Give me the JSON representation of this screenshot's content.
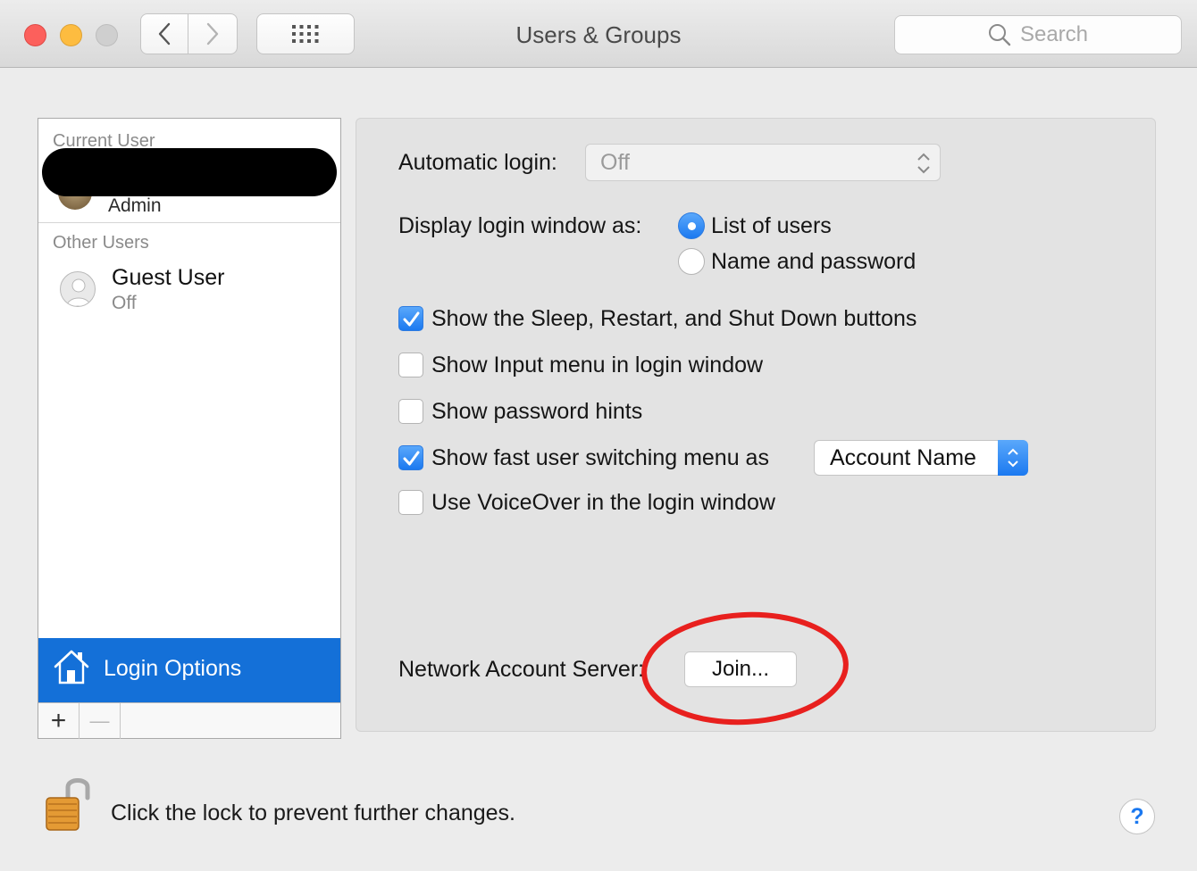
{
  "window": {
    "title": "Users & Groups",
    "search_placeholder": "Search"
  },
  "sidebar": {
    "current_user_label": "Current User",
    "current_user_role": "Admin",
    "other_users_label": "Other Users",
    "guest": {
      "name": "Guest User",
      "status": "Off"
    },
    "login_options_label": "Login Options",
    "add_label": "+",
    "remove_label": "—"
  },
  "main": {
    "automatic_login": {
      "label": "Automatic login:",
      "value": "Off"
    },
    "display_login": {
      "label": "Display login window as:",
      "options": [
        {
          "label": "List of users",
          "selected": true
        },
        {
          "label": "Name and password",
          "selected": false
        }
      ]
    },
    "checkboxes": [
      {
        "label": "Show the Sleep, Restart, and Shut Down buttons",
        "checked": true
      },
      {
        "label": "Show Input menu in login window",
        "checked": false
      },
      {
        "label": "Show password hints",
        "checked": false
      },
      {
        "label": "Show fast user switching menu as",
        "checked": true
      },
      {
        "label": "Use VoiceOver in the login window",
        "checked": false
      }
    ],
    "fast_user_switching_value": "Account Name",
    "network_account_server": {
      "label": "Network Account Server:",
      "button": "Join..."
    }
  },
  "footer": {
    "lock_text": "Click the lock to prevent further changes.",
    "help_label": "?"
  },
  "colors": {
    "accent": "#1470d8",
    "annotation": "#e8201e"
  }
}
